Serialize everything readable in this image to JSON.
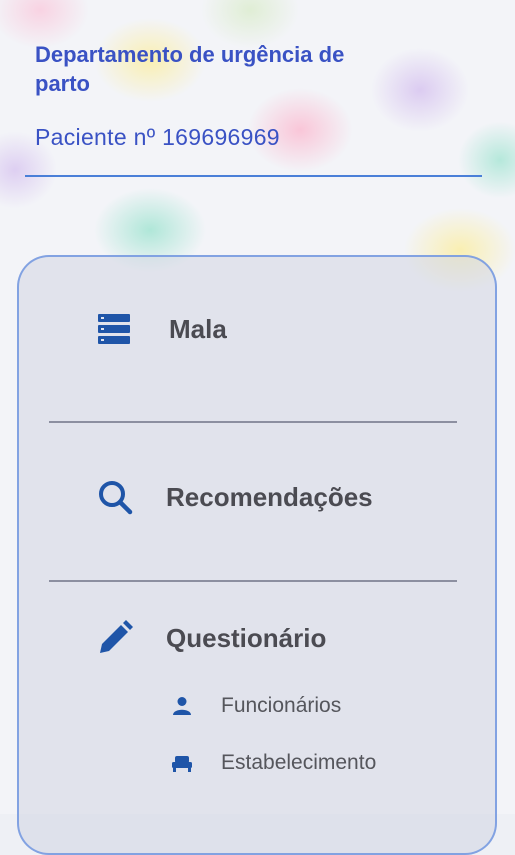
{
  "header": {
    "department": "Departamento de urgência de parto",
    "patient": "Paciente nº 169696969"
  },
  "menu": {
    "items": [
      {
        "label": "Mala",
        "icon": "storage-icon"
      },
      {
        "label": "Recomendações",
        "icon": "search-icon"
      },
      {
        "label": "Questionário",
        "icon": "pencil-icon"
      }
    ],
    "subitems": [
      {
        "label": "Funcionários",
        "icon": "person-icon"
      },
      {
        "label": "Estabelecimento",
        "icon": "bed-icon"
      }
    ]
  },
  "colors": {
    "accent": "#3a52c4",
    "icon": "#1f55a8",
    "text": "#4b4b52",
    "border": "#789be1"
  }
}
